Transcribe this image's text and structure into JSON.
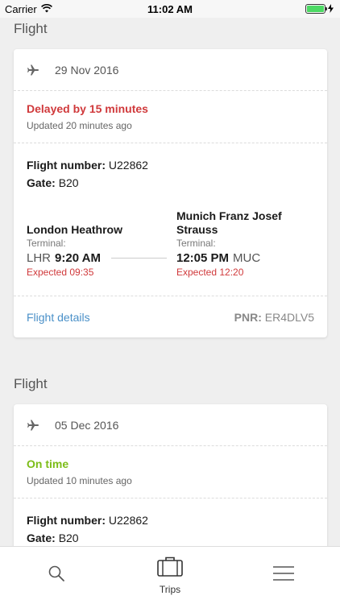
{
  "status_bar": {
    "carrier": "Carrier",
    "time": "11:02 AM",
    "battery_percent": 100
  },
  "flights": [
    {
      "section_title": "Flight",
      "date": "29 Nov 2016",
      "status": "Delayed by 15 minutes",
      "status_color": "#d0393b",
      "updated": "Updated 20 minutes ago",
      "flight_number_label": "Flight number:",
      "flight_number": "U22862",
      "gate_label": "Gate:",
      "gate": "B20",
      "departure": {
        "airport": "London Heathrow",
        "terminal": "Terminal:",
        "code": "LHR",
        "time": "9:20 AM",
        "expected": "Expected 09:35"
      },
      "arrival": {
        "airport": "Munich Franz Josef Strauss",
        "terminal": "Terminal:",
        "code": "MUC",
        "time": "12:05 PM",
        "expected": "Expected 12:20"
      },
      "details_link": "Flight details",
      "pnr_label": "PNR:",
      "pnr": "ER4DLV5"
    },
    {
      "section_title": "Flight",
      "date": "05 Dec 2016",
      "status": "On time",
      "status_color": "#7cbd18",
      "updated": "Updated 10 minutes ago",
      "flight_number_label": "Flight number:",
      "flight_number": "U22862",
      "gate_label": "Gate:",
      "gate": "B20"
    }
  ],
  "tabbar": {
    "search_icon": "search-icon",
    "trips_label": "Trips",
    "menu_icon": "menu-icon"
  }
}
